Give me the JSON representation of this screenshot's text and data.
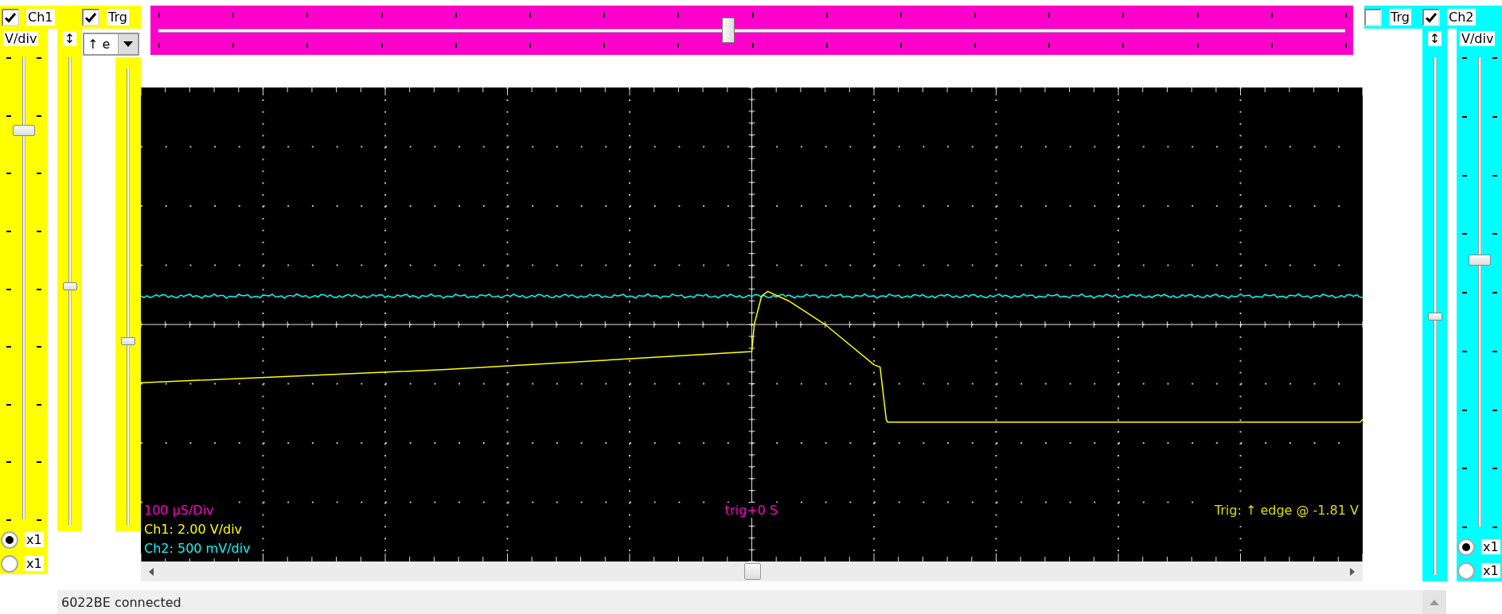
{
  "channels": [
    {
      "name": "Ch1",
      "color": "#ffff00",
      "checked": true,
      "trigger_label": "Trg",
      "trigger_checked": true,
      "vdiv_label": "V/div",
      "vdiv_slider": {
        "level": 0.85
      },
      "offset_label": "↕",
      "offset_slider": {
        "level": 0.51
      },
      "probes": [
        {
          "label": "x1",
          "selected": true
        },
        {
          "label": "x1",
          "selected": false
        }
      ]
    },
    {
      "name": "Ch2",
      "color": "#00ffff",
      "checked": true,
      "trigger_label": "Trg",
      "trigger_checked": false,
      "vdiv_label": "V/div",
      "vdiv_slider": {
        "level": 0.57
      },
      "offset_label": "↕",
      "offset_slider": {
        "level": 0.5
      },
      "probes": [
        {
          "label": "x1",
          "selected": true
        },
        {
          "label": "x1",
          "selected": false
        }
      ]
    }
  ],
  "trigger": {
    "mode": "↑ e",
    "level": 0.4
  },
  "timebase": {
    "level": 0.48
  },
  "scope": {
    "timebase": "100 µS/Div",
    "ch1_scale": "Ch1: 2.00 V/div",
    "ch2_scale": "Ch2: 500 mV/div",
    "trigger_position": "trig+0 S",
    "trigger_info": "Trig: ↑ edge @ -1.81 V"
  },
  "status_bar": {
    "text": "6022BE connected"
  }
}
